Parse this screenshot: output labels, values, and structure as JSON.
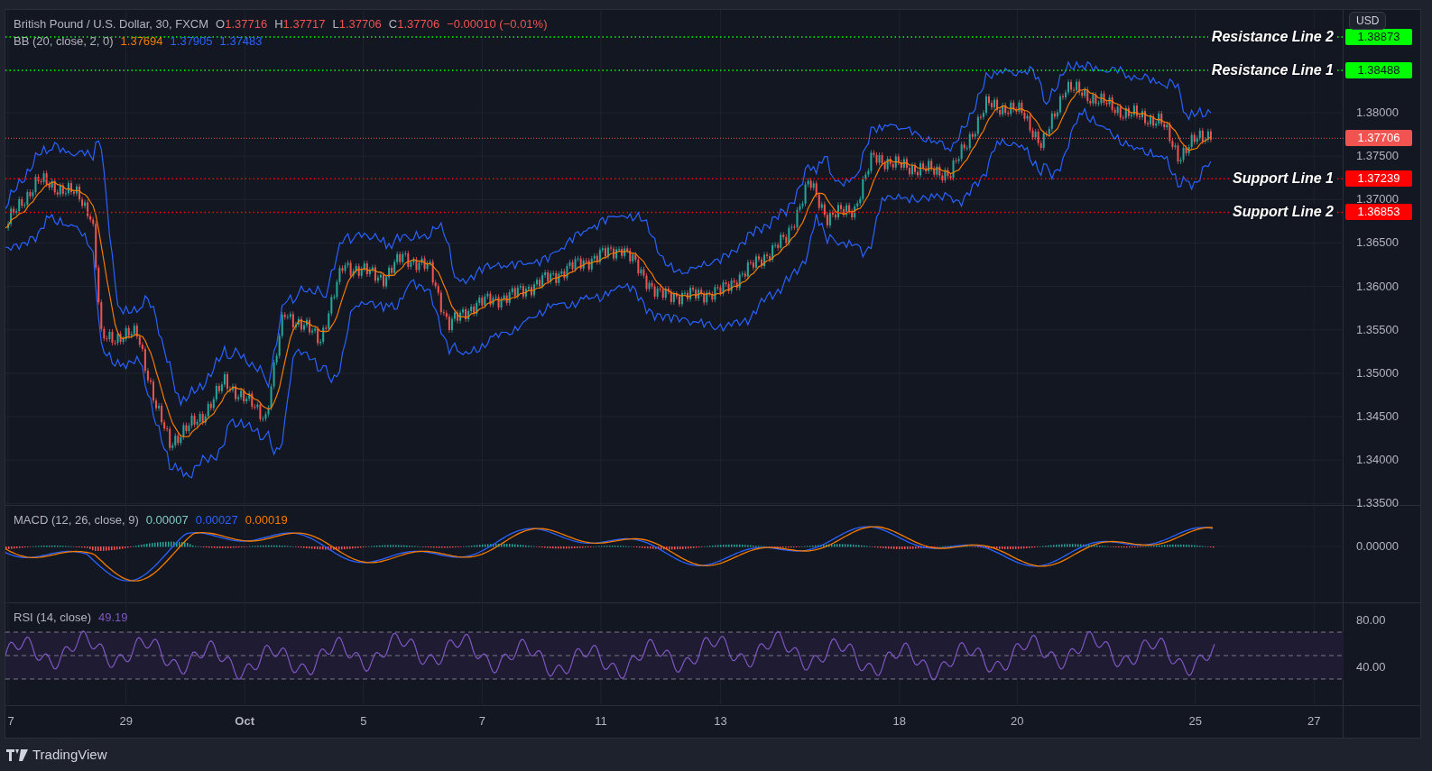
{
  "chart": {
    "legend": {
      "symbol": "British Pound / U.S. Dollar, 30, FXCM",
      "ohlc": [
        {
          "letter": "O",
          "value": "1.37716"
        },
        {
          "letter": "H",
          "value": "1.37717"
        },
        {
          "letter": "L",
          "value": "1.37706"
        },
        {
          "letter": "C",
          "value": "1.37706"
        }
      ],
      "change": "−0.00010 (−0.01%)"
    },
    "bb": {
      "label": "BB (20, close, 2, 0)",
      "values": [
        {
          "text": "1.37694",
          "color": "#f57c00"
        },
        {
          "text": "1.37905",
          "color": "#2962ff"
        },
        {
          "text": "1.37483",
          "color": "#2962ff"
        }
      ]
    },
    "horizontal_lines": [
      {
        "kind": "resistance",
        "label": "Resistance Line 2",
        "price": "1.38873",
        "color": "#00ff00"
      },
      {
        "kind": "resistance",
        "label": "Resistance Line 1",
        "price": "1.38488",
        "color": "#00ff00"
      },
      {
        "kind": "support",
        "label": "Support Line 1",
        "price": "1.37239",
        "color": "#ff0000"
      },
      {
        "kind": "support",
        "label": "Support Line 2",
        "price": "1.36853",
        "color": "#ff0000"
      }
    ],
    "last_price": "1.37706",
    "price_axis": {
      "currency": "USD",
      "ticks": [
        "1.38000",
        "1.37500",
        "1.37000",
        "1.36500",
        "1.36000",
        "1.35500",
        "1.35000",
        "1.34500",
        "1.34000",
        "1.33500"
      ]
    }
  },
  "macd": {
    "label": "MACD (12, 26, close, 9)",
    "values": [
      {
        "text": "0.00007",
        "color": "#80cbc4"
      },
      {
        "text": "0.00027",
        "color": "#2962ff"
      },
      {
        "text": "0.00019",
        "color": "#f57c00"
      }
    ],
    "ticks": [
      "0.00000"
    ]
  },
  "rsi": {
    "label": "RSI (14, close)",
    "value": "49.19",
    "ticks": [
      "80.00",
      "40.00"
    ]
  },
  "time_axis": [
    {
      "kind": "day",
      "label": "7"
    },
    {
      "kind": "day",
      "label": "29"
    },
    {
      "kind": "month",
      "label": "Oct"
    },
    {
      "kind": "day",
      "label": "5"
    },
    {
      "kind": "day",
      "label": "7"
    },
    {
      "kind": "day",
      "label": "11"
    },
    {
      "kind": "day",
      "label": "13"
    },
    {
      "kind": "day",
      "label": "18"
    },
    {
      "kind": "day",
      "label": "20"
    },
    {
      "kind": "day",
      "label": "25"
    },
    {
      "kind": "day",
      "label": "27"
    }
  ],
  "footer": {
    "brand": "TradingView"
  }
}
